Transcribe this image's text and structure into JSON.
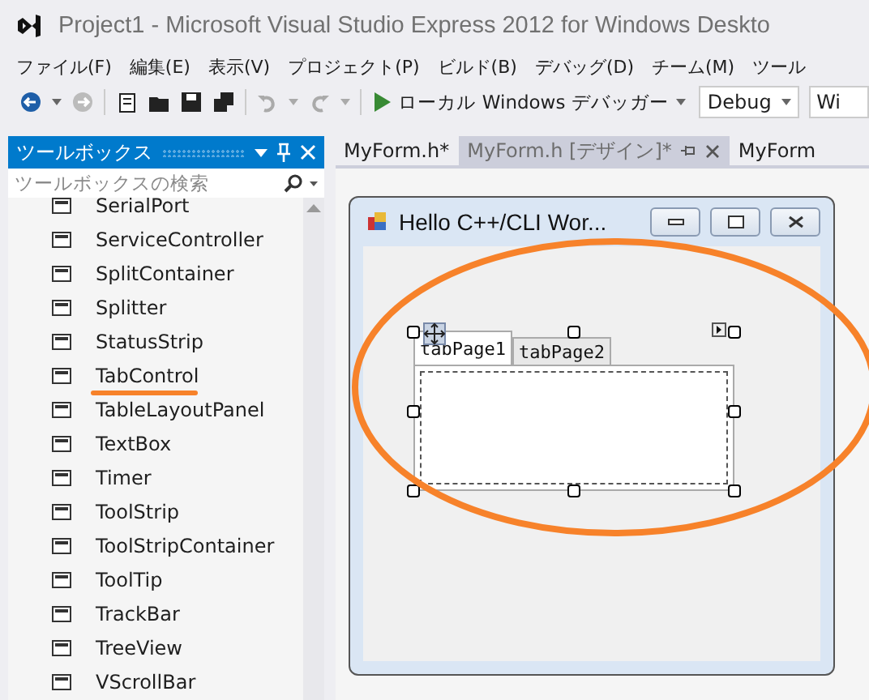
{
  "window": {
    "title": "Project1 - Microsoft Visual Studio Express 2012 for Windows Deskto"
  },
  "menu": [
    "ファイル(F)",
    "編集(E)",
    "表示(V)",
    "プロジェクト(P)",
    "ビルド(B)",
    "デバッグ(D)",
    "チーム(M)",
    "ツール"
  ],
  "toolbar": {
    "run_label": "ローカル Windows デバッガー",
    "configuration": "Debug",
    "platform": "Wi"
  },
  "toolbox": {
    "title": "ツールボックス",
    "search": {
      "placeholder": "ツールボックスの検索"
    },
    "items": [
      "SerialPort",
      "ServiceController",
      "SplitContainer",
      "Splitter",
      "StatusStrip",
      "TabControl",
      "TableLayoutPanel",
      "TextBox",
      "Timer",
      "ToolStrip",
      "ToolStripContainer",
      "ToolTip",
      "TrackBar",
      "TreeView",
      "VScrollBar"
    ]
  },
  "editor_tabs": [
    {
      "label": "MyForm.h*",
      "selected": false
    },
    {
      "label": "MyForm.h [デザイン]*",
      "selected": true
    },
    {
      "label": "MyForm",
      "selected": false
    }
  ],
  "form": {
    "title": "Hello C++/CLI Wor...",
    "tabs": [
      {
        "label": "tabPage1",
        "selected": true
      },
      {
        "label": "tabPage2",
        "selected": false
      }
    ]
  }
}
